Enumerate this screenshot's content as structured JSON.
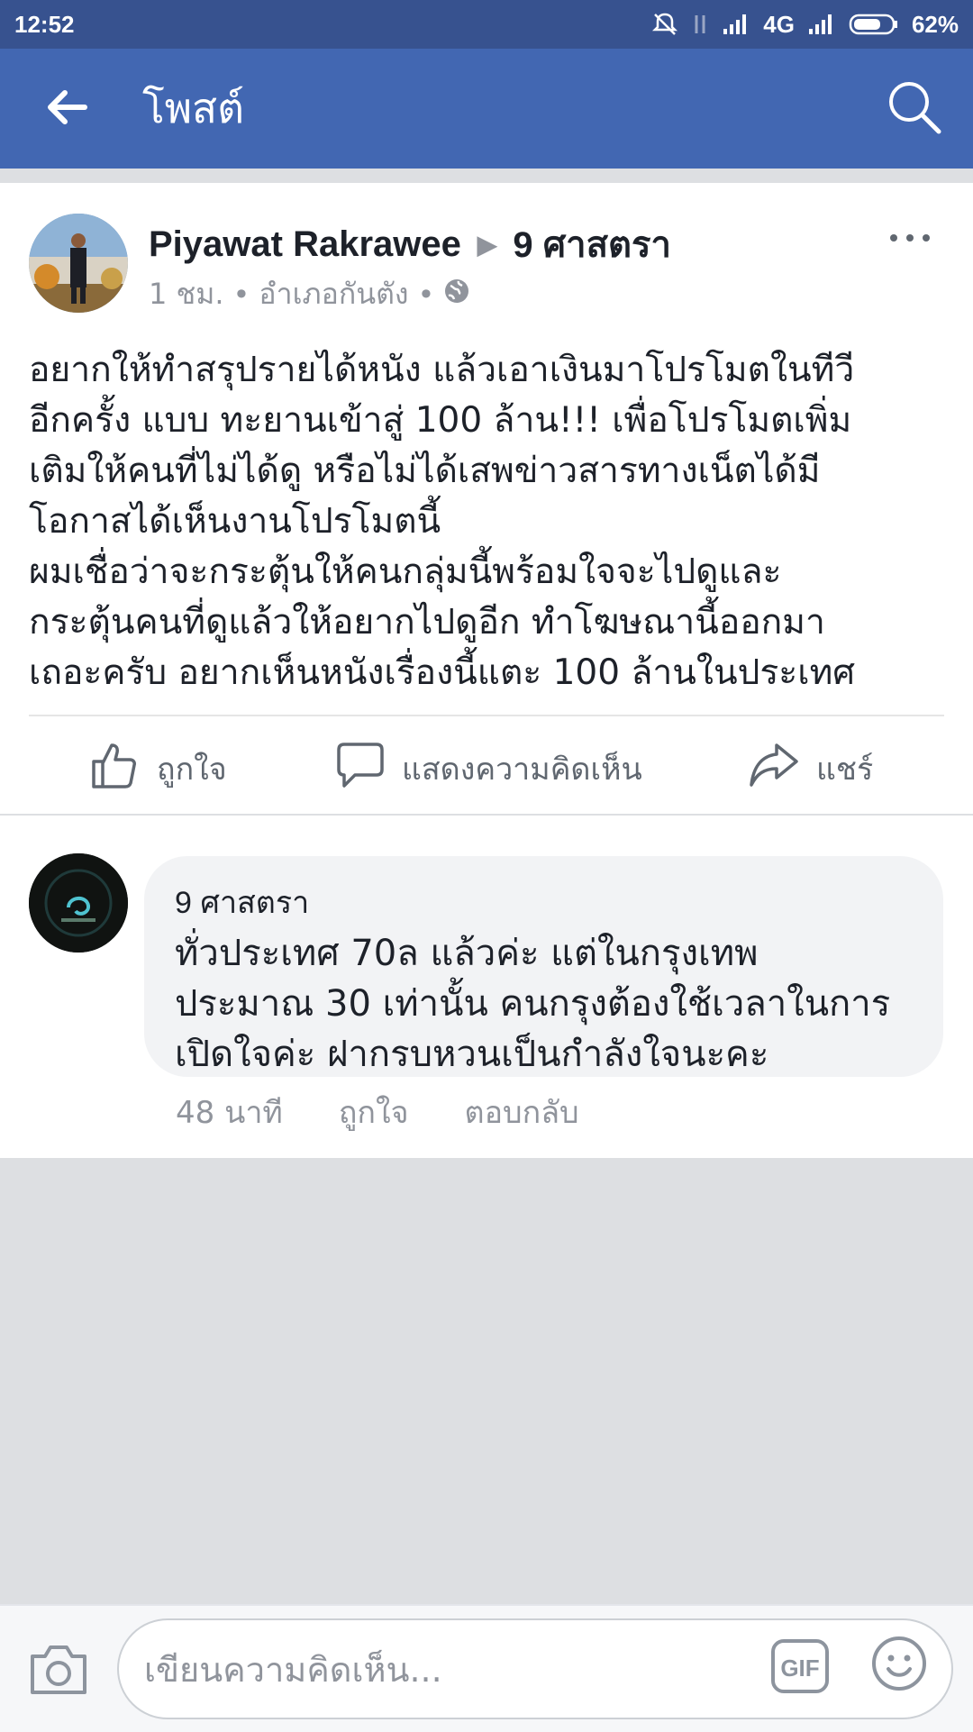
{
  "status_bar": {
    "time": "12:52",
    "network": "4G",
    "battery": "62%"
  },
  "app_bar": {
    "title": "โพสต์",
    "icons": [
      "back-arrow-icon",
      "search-icon"
    ]
  },
  "post": {
    "author": "Piyawat Rakrawee",
    "target": "9 ศาสตรา",
    "time": "1 ชม.",
    "location": "อำเภอกันตัง",
    "dot": "•",
    "text": "อยากให้ทำสรุปรายได้หนัง แล้วเอาเงินมาโปรโมตในทีวี\nอีกครั้ง แบบ ทะยานเข้าสู่ 100 ล้าน!!! เพื่อโปรโมตเพิ่ม\nเติมให้คนที่ไม่ได้ดู หรือไม่ได้เสพข่าวสารทางเน็ตได้มี\nโอกาสได้เห็นงานโปรโมตนี้\nผมเชื่อว่าจะกระตุ้นให้คนกลุ่มนี้พร้อมใจจะไปดูและ\nกระตุ้นคนที่ดูแล้วให้อยากไปดูอีก ทำโฆษณานี้ออกมา\nเถอะครับ อยากเห็นหนังเรื่องนี้แตะ 100 ล้านในประเทศ",
    "actions": {
      "like": "ถูกใจ",
      "comment": "แสดงความคิดเห็น",
      "share": "แชร์"
    }
  },
  "comment": {
    "author": "9 ศาสตรา",
    "text": "ทั่วประเทศ 70ล แล้วค่ะ แต่ในกรุงเทพ\nประมาณ 30 เท่านั้น คนกรุงต้องใช้เวลาในการ\nเปิดใจค่ะ ฝากรบหวนเป็นกำลังใจนะคะ",
    "time": "48 นาที",
    "like": "ถูกใจ",
    "reply": "ตอบกลับ"
  },
  "composer": {
    "placeholder": "เขียนความคิดเห็น...",
    "icons": [
      "camera-icon",
      "gif-icon",
      "emoji-icon"
    ]
  },
  "colors": {
    "brand": "#4267b2",
    "status_bar": "#37528f",
    "secondary_text": "#90949c",
    "background": "#dddfe2"
  }
}
